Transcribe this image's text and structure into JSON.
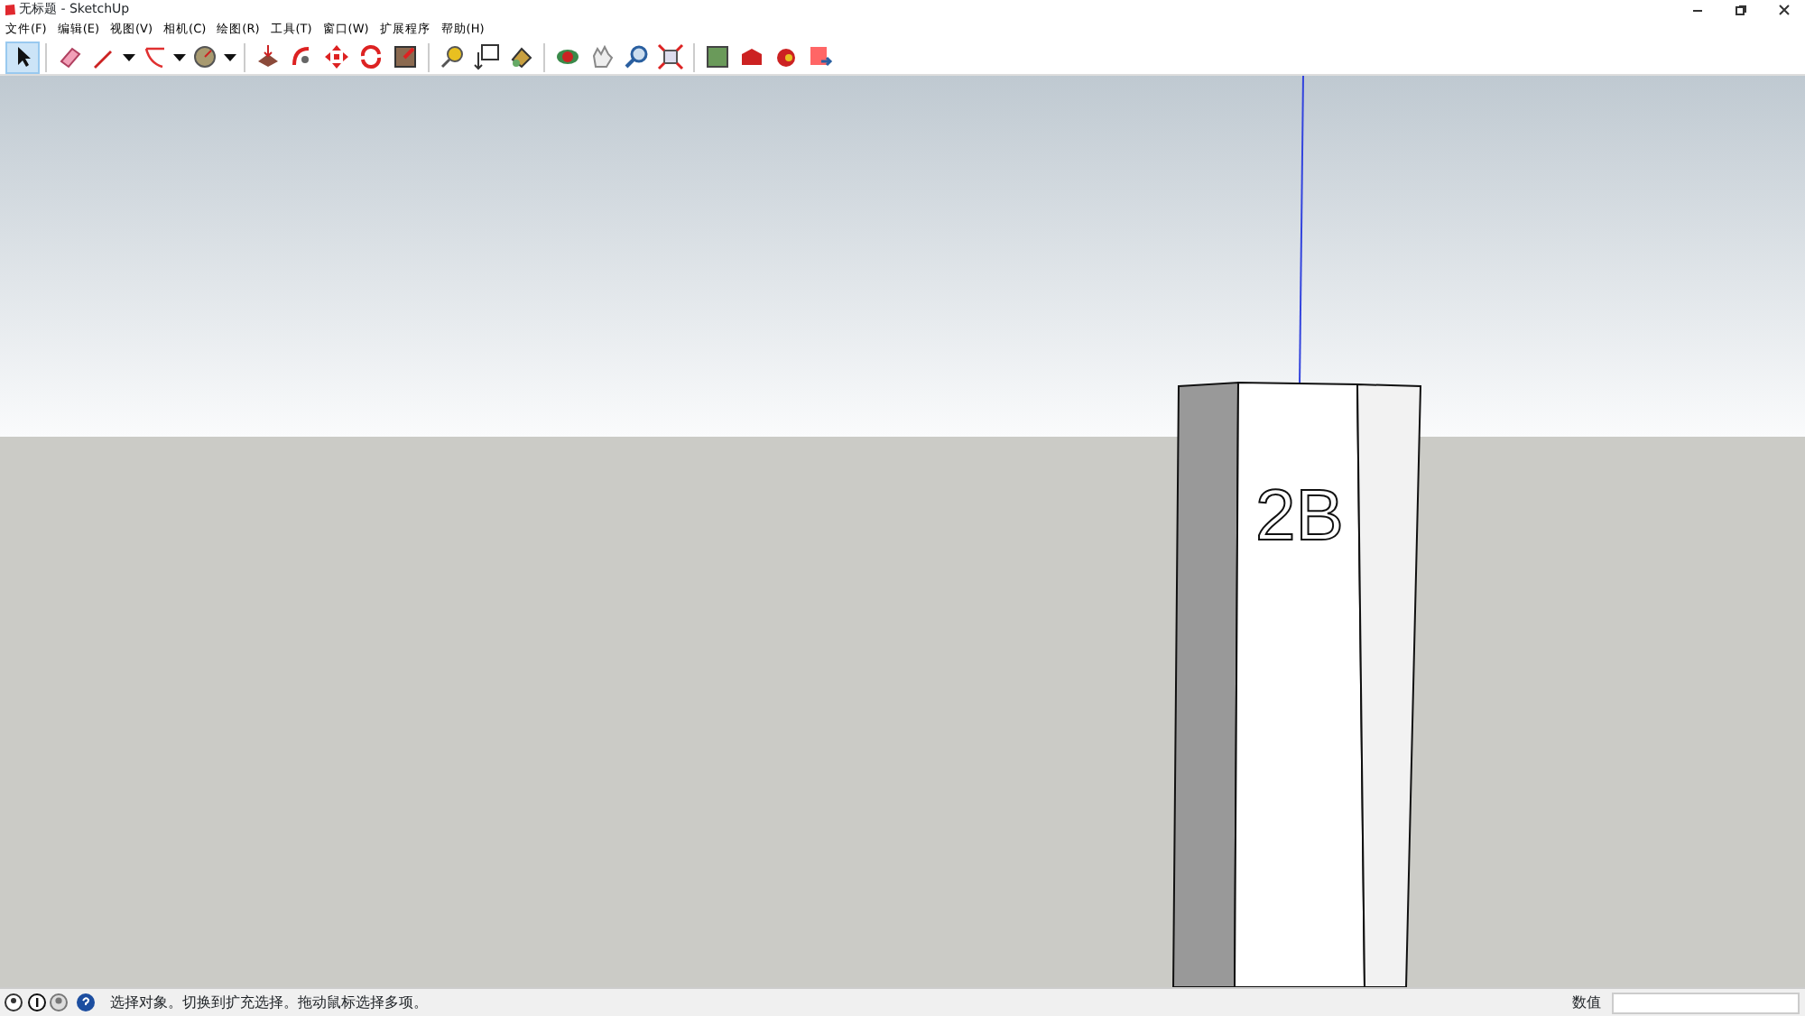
{
  "window": {
    "title": "无标题 - SketchUp"
  },
  "menu": [
    "文件(F)",
    "编辑(E)",
    "视图(V)",
    "相机(C)",
    "绘图(R)",
    "工具(T)",
    "窗口(W)",
    "扩展程序",
    "帮助(H)"
  ],
  "toolbar": {
    "groups": [
      [
        {
          "kind": "tool",
          "selected": true
        }
      ],
      [
        {
          "kind": "tool",
          "selected": false
        },
        {
          "kind": "tool",
          "selected": false
        },
        {
          "kind": "dropdown",
          "selected": false
        },
        {
          "kind": "tool",
          "selected": false
        },
        {
          "kind": "dropdown",
          "selected": false
        },
        {
          "kind": "tool",
          "selected": false
        },
        {
          "kind": "dropdown",
          "selected": false
        }
      ],
      [
        {
          "kind": "tool",
          "selected": false
        },
        {
          "kind": "tool",
          "selected": false
        },
        {
          "kind": "tool",
          "selected": false
        },
        {
          "kind": "tool",
          "selected": false
        },
        {
          "kind": "tool",
          "selected": false
        }
      ],
      [
        {
          "kind": "tool",
          "selected": false
        },
        {
          "kind": "tool",
          "selected": false
        },
        {
          "kind": "tool",
          "selected": false
        }
      ],
      [
        {
          "kind": "tool",
          "selected": false
        },
        {
          "kind": "tool",
          "selected": false
        },
        {
          "kind": "tool",
          "selected": false
        },
        {
          "kind": "tool",
          "selected": false
        }
      ],
      [
        {
          "kind": "tool",
          "selected": false
        },
        {
          "kind": "tool",
          "selected": false
        },
        {
          "kind": "tool",
          "selected": false
        },
        {
          "kind": "tool",
          "selected": false
        }
      ]
    ]
  },
  "viewport": {
    "label_3d": "2B"
  },
  "status_bar": {
    "hint": "选择对象。切换到扩充选择。拖动鼠标选择多项。",
    "measure_label": "数值"
  }
}
